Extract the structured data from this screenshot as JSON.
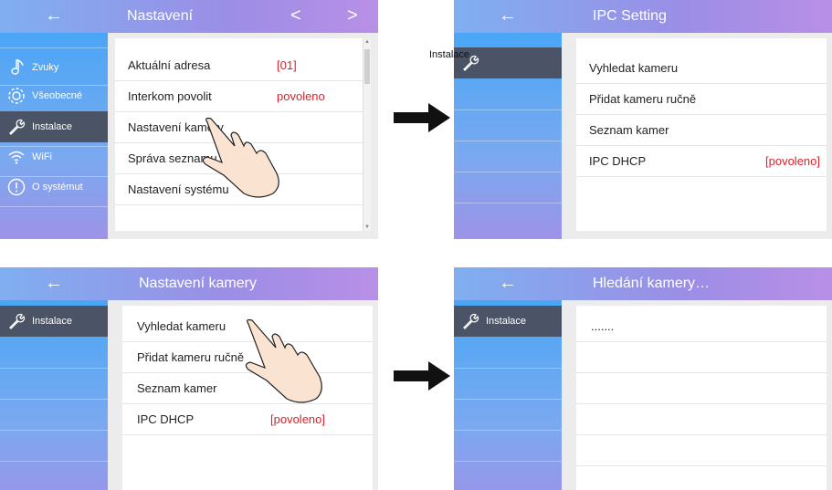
{
  "colors": {
    "accent": "#e0202a",
    "sidebar_active": "#4b5366"
  },
  "icons": {
    "back": "arrow-left-icon",
    "prev": "chevron-left-icon",
    "next": "chevron-right-icon",
    "step_arrow": "right-arrow-icon"
  },
  "back_symbol": "←",
  "prev_symbol": "<",
  "next_symbol": ">",
  "panel1": {
    "title": "Nastavení",
    "sidebar": [
      {
        "label": "Zvuky",
        "icon": "music-note-icon"
      },
      {
        "label": "Všeobecné",
        "icon": "gear-icon"
      },
      {
        "label": "Instalace",
        "icon": "wrench-icon",
        "active": true
      },
      {
        "label": "WiFi",
        "icon": "wifi-icon"
      },
      {
        "label": "O systémut",
        "icon": "info-icon"
      }
    ],
    "rows": [
      {
        "label": "Aktuální adresa",
        "value": "[01]"
      },
      {
        "label": "Interkom povolit",
        "value": "povoleno"
      },
      {
        "label": "Nastavení kamery",
        "value": ""
      },
      {
        "label": "Správa seznamu monitorů",
        "value": ""
      },
      {
        "label": "Nastavení systému",
        "value": ""
      }
    ]
  },
  "panel2": {
    "title": "IPC Setting",
    "sidebar_label": "Instalace",
    "rows": [
      {
        "label": "Vyhledat kameru",
        "value": ""
      },
      {
        "label": "Přidat kameru ručně",
        "value": ""
      },
      {
        "label": "Seznam kamer",
        "value": ""
      },
      {
        "label": "IPC DHCP",
        "value": "[povoleno]"
      }
    ]
  },
  "panel3": {
    "title": "Nastavení kamery",
    "sidebar_label": "Instalace",
    "rows": [
      {
        "label": "Vyhledat kameru",
        "value": ""
      },
      {
        "label": "Přidat kameru ručně",
        "value": ""
      },
      {
        "label": "Seznam kamer",
        "value": ""
      },
      {
        "label": "IPC DHCP",
        "value": "[povoleno]"
      }
    ]
  },
  "panel4": {
    "title": "Hledání kamery…",
    "sidebar_label": "Instalace",
    "rows": [
      {
        "label": ".......",
        "value": ""
      }
    ]
  }
}
